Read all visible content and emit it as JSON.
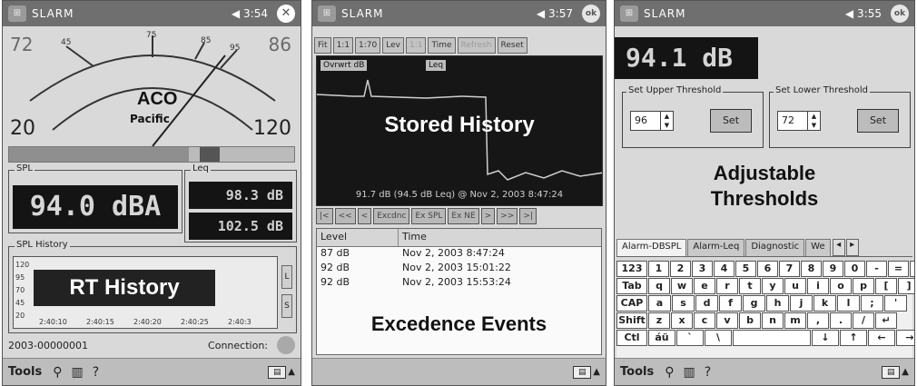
{
  "screen1": {
    "title": {
      "app": "SLARM",
      "time": "3:54"
    },
    "gauge": {
      "minor_low": "72",
      "minor_high": "86",
      "major_low": "20",
      "major_high": "120",
      "tick_labels": [
        "45",
        "75",
        "85",
        "95"
      ],
      "brand_top": "ACO",
      "brand_bottom": "Pacific",
      "needle_value": 94.0
    },
    "level_bar_fraction": 0.63,
    "spl": {
      "label": "SPL",
      "value": "94.0 dBA"
    },
    "leq": {
      "label": "Leq",
      "value1": "98.3 dB",
      "value2": "102.5 dB"
    },
    "history": {
      "label": "SPL History",
      "y_ticks": [
        "120",
        "95",
        "70",
        "45",
        "20"
      ],
      "x_ticks": [
        "2:40:10",
        "2:40:15",
        "2:40:20",
        "2:40:25",
        "2:40:3"
      ],
      "side_buttons": [
        "L",
        "S"
      ],
      "caption": "RT History"
    },
    "status": {
      "id": "2003-00000001",
      "connection": "Connection:"
    },
    "menu": {
      "tools": "Tools"
    }
  },
  "screen2": {
    "title": {
      "app": "SLARM",
      "time": "3:57"
    },
    "toolbar": [
      "Fit",
      "1:1",
      "1:70",
      "Lev",
      "1:1",
      "Time",
      "Refresh",
      "Reset"
    ],
    "graph": {
      "caption": "Stored History",
      "readout": "91.7 dB (94.5 dB Leq) @ Nov 2, 2003 8:47:24",
      "tag1": "Ovrwrt dB",
      "tag2": "Leq"
    },
    "nav": [
      "|<",
      "<<",
      "<",
      "Excdnc",
      "Ex SPL",
      "Ex NE",
      ">",
      ">>",
      ">|"
    ],
    "table": {
      "headers": [
        "Level",
        "Time"
      ],
      "rows": [
        {
          "level": "87 dB",
          "time": "Nov 2, 2003 8:47:24"
        },
        {
          "level": "92 dB",
          "time": "Nov 2, 2003 15:01:22"
        },
        {
          "level": "92 dB",
          "time": "Nov 2, 2003 15:53:24"
        }
      ],
      "caption": "Excedence Events"
    },
    "menu": {}
  },
  "screen3": {
    "title": {
      "app": "SLARM",
      "time": "3:55"
    },
    "level": "94.1 dB",
    "upper": {
      "label": "Set Upper Threshold",
      "value": "96",
      "button": "Set"
    },
    "lower": {
      "label": "Set Lower Threshold",
      "value": "72",
      "button": "Set"
    },
    "caption_line1": "Adjustable",
    "caption_line2": "Thresholds",
    "tabs": [
      "Alarm-DBSPL",
      "Alarm-Leq",
      "Diagnostic",
      "We"
    ],
    "keyboard": {
      "row1": [
        "123",
        "1",
        "2",
        "3",
        "4",
        "5",
        "6",
        "7",
        "8",
        "9",
        "0",
        "-",
        "=",
        "◆"
      ],
      "row2": [
        "Tab",
        "q",
        "w",
        "e",
        "r",
        "t",
        "y",
        "u",
        "i",
        "o",
        "p",
        "[",
        "]"
      ],
      "row3": [
        "CAP",
        "a",
        "s",
        "d",
        "f",
        "g",
        "h",
        "j",
        "k",
        "l",
        ";",
        "'"
      ],
      "row4": [
        "Shift",
        "z",
        "x",
        "c",
        "v",
        "b",
        "n",
        "m",
        ",",
        ".",
        "/",
        "↵"
      ],
      "row5": [
        "Ctl",
        "áü",
        "`",
        "\\",
        "",
        "↓",
        "↑",
        "←",
        "→"
      ]
    },
    "menu": {
      "tools": "Tools"
    }
  },
  "colors": {
    "display_bg": "#141414",
    "chrome": "#6f6f6f",
    "panel": "#d9d9d9"
  }
}
